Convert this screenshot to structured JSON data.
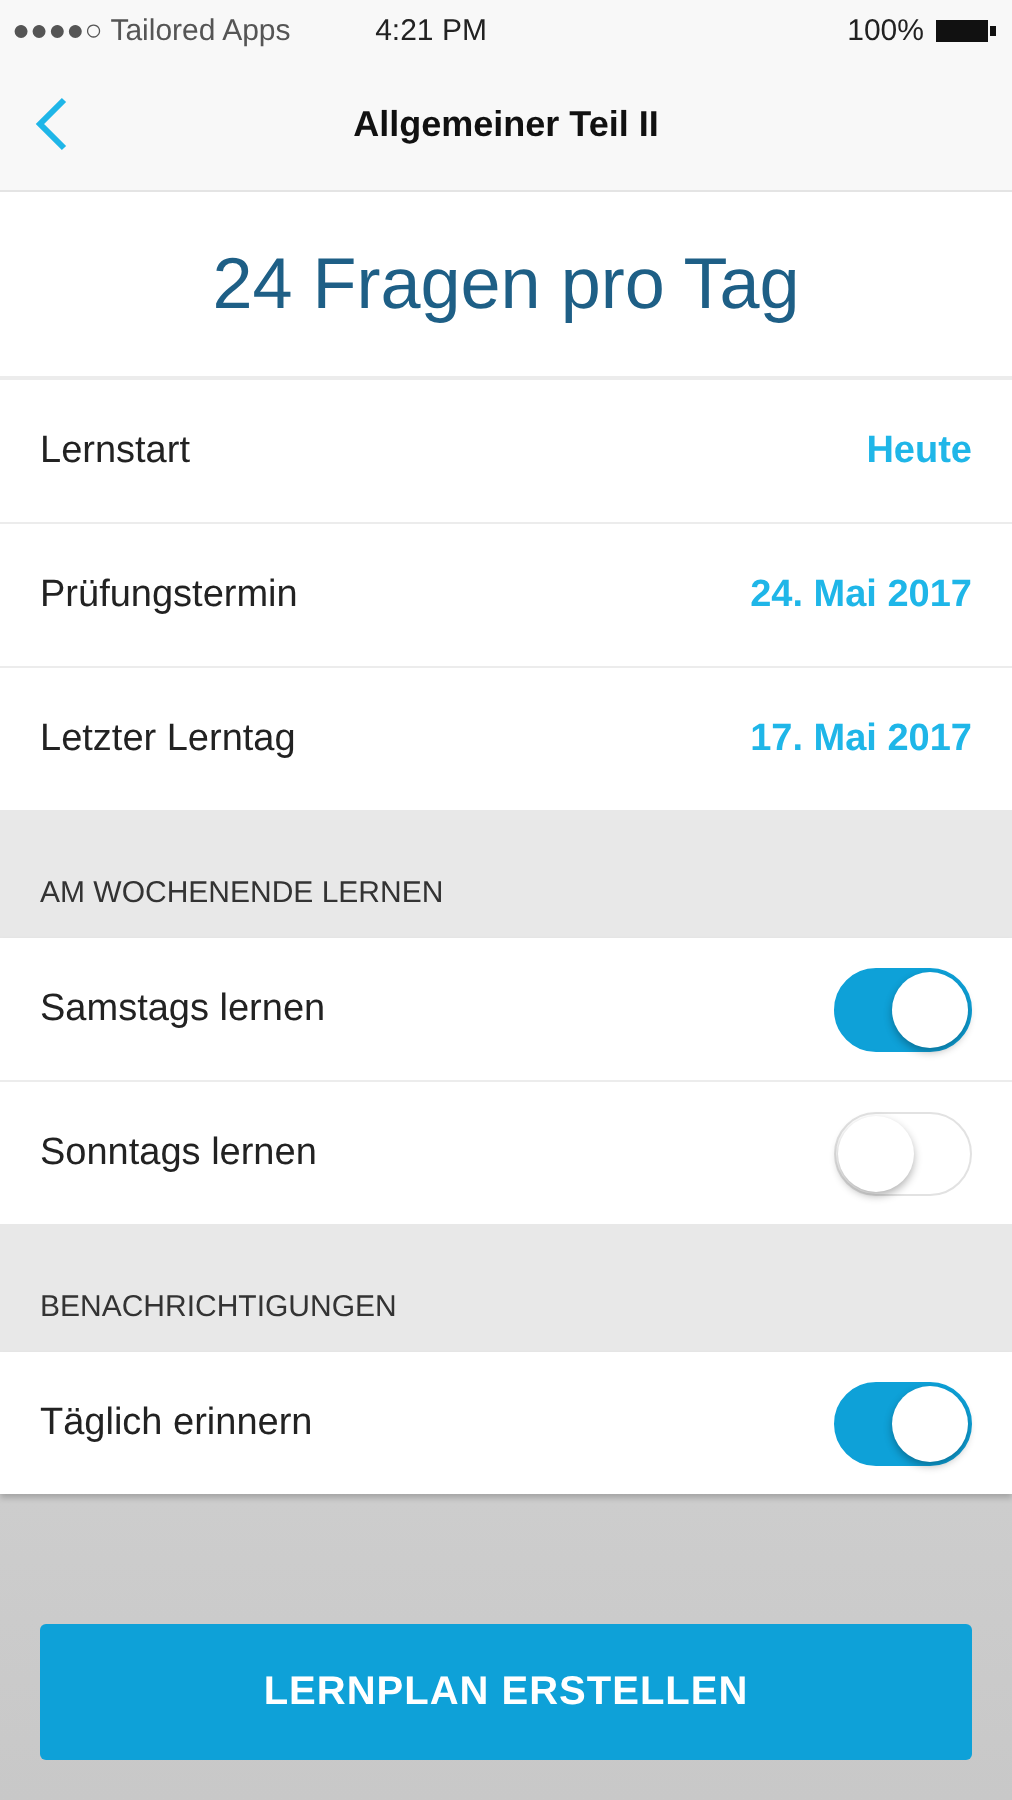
{
  "status_bar": {
    "carrier": "●●●●○ Tailored Apps",
    "time": "4:21 PM",
    "battery": "100%"
  },
  "nav": {
    "title": "Allgemeiner Teil II"
  },
  "headline": "24 Fragen pro Tag",
  "dates": [
    {
      "label": "Lernstart",
      "value": "Heute"
    },
    {
      "label": "Prüfungstermin",
      "value": "24. Mai 2017"
    },
    {
      "label": "Letzter Lerntag",
      "value": "17. Mai 2017"
    }
  ],
  "sections": [
    {
      "title": "AM WOCHENENDE LERNEN",
      "rows": [
        {
          "label": "Samstags lernen",
          "on": true
        },
        {
          "label": "Sonntags lernen",
          "on": false
        }
      ]
    },
    {
      "title": "BENACHRICHTIGUNGEN",
      "rows": [
        {
          "label": "Täglich erinnern",
          "on": true
        }
      ]
    }
  ],
  "button": "LERNPLAN ERSTELLEN"
}
